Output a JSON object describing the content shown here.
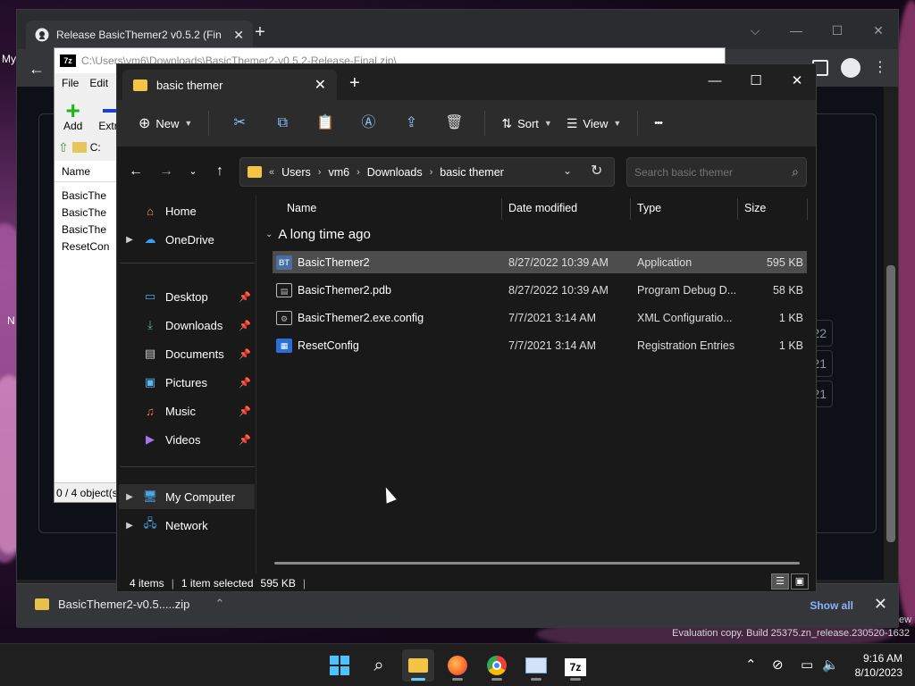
{
  "chrome": {
    "tab_title": "Release BasicThemer2 v0.5.2 (Fin",
    "tab_close": "✕",
    "new_tab": "+",
    "left_edge_text": "My",
    "left_edge_text2": "N",
    "repo_dates": [
      "22",
      "21",
      "21"
    ],
    "download_filename": "BasicThemer2-v0.5.....zip",
    "show_all": "Show all",
    "download_close": "✕",
    "edge_text": "ew"
  },
  "sevenzip": {
    "title": "C:\\Users\\vm6\\Downloads\\BasicThemer2-v0.5.2-Release-Final.zip\\",
    "logo": "7z",
    "menu": [
      "File",
      "Edit"
    ],
    "tools": {
      "add": "Add",
      "extract": "Extra"
    },
    "addr_prefix": "C:",
    "column_name": "Name",
    "files": [
      "BasicThe",
      "BasicThe",
      "BasicThe",
      "ResetCon"
    ],
    "status": "0 / 4 object(s"
  },
  "explorer": {
    "tab_title": "basic themer",
    "tab_close": "✕",
    "new_tab": "+",
    "commands": {
      "new": "New",
      "sort": "Sort",
      "view": "View",
      "more": "•••"
    },
    "breadcrumb": {
      "overflow": "«",
      "parts": [
        "Users",
        "vm6",
        "Downloads",
        "basic themer"
      ]
    },
    "search_placeholder": "Search basic themer",
    "nav": {
      "home": "Home",
      "onedrive": "OneDrive",
      "desktop": "Desktop",
      "downloads": "Downloads",
      "documents": "Documents",
      "pictures": "Pictures",
      "music": "Music",
      "videos": "Videos",
      "my_computer": "My Computer",
      "network": "Network"
    },
    "columns": {
      "name": "Name",
      "date": "Date modified",
      "type": "Type",
      "size": "Size"
    },
    "group": "A long time ago",
    "files": [
      {
        "name": "BasicThemer2",
        "date": "8/27/2022 10:39 AM",
        "type": "Application",
        "size": "595 KB",
        "icon": "BT"
      },
      {
        "name": "BasicThemer2.pdb",
        "date": "8/27/2022 10:39 AM",
        "type": "Program Debug D...",
        "size": "58 KB",
        "icon": "pdb"
      },
      {
        "name": "BasicThemer2.exe.config",
        "date": "7/7/2021 3:14 AM",
        "type": "XML Configuratio...",
        "size": "1 KB",
        "icon": "cfg"
      },
      {
        "name": "ResetConfig",
        "date": "7/7/2021 3:14 AM",
        "type": "Registration Entries",
        "size": "1 KB",
        "icon": "reg"
      }
    ],
    "status": {
      "items": "4 items",
      "selected": "1 item selected",
      "size": "595 KB",
      "sep": "|"
    }
  },
  "watermark": {
    "line2": "Evaluation copy. Build 25375.zn_release.230520-1632"
  },
  "taskbar": {
    "sevenzip_label": "7z",
    "time": "9:16 AM",
    "date": "8/10/2023"
  },
  "colors": {
    "accent": "#60cdff",
    "selection": "#4d4d4d",
    "explorer_bg": "#191919",
    "chrome_bg": "#202124"
  }
}
